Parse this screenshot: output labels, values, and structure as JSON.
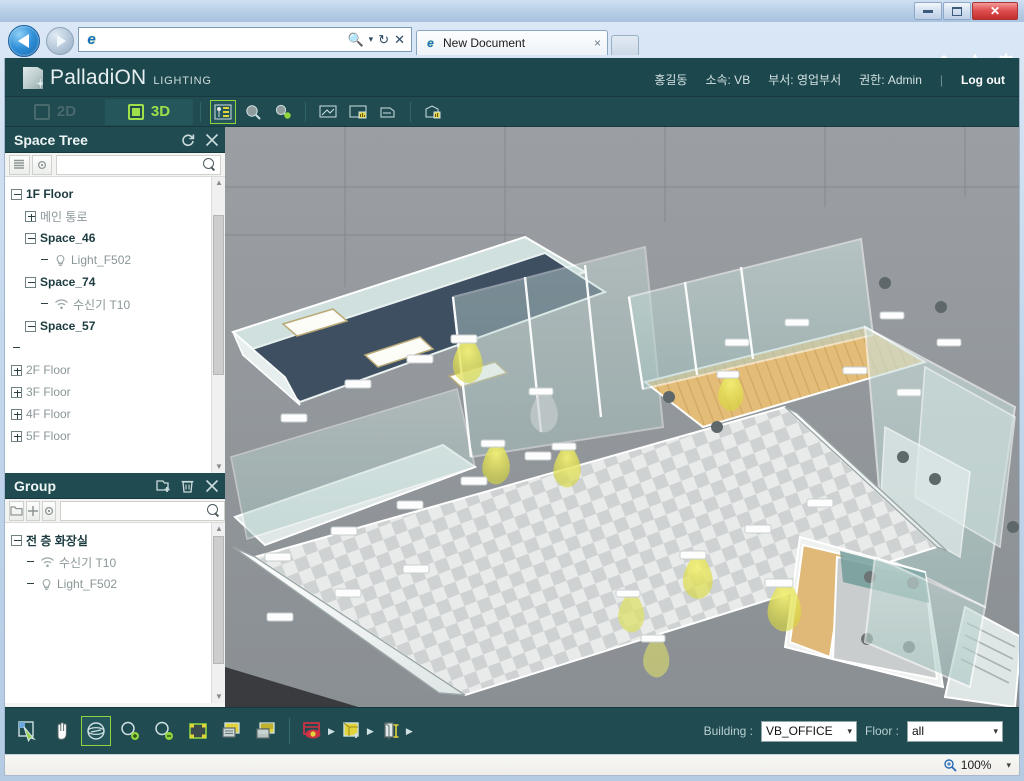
{
  "browser": {
    "window_controls": {
      "minimize": "Minimize",
      "restore": "Restore",
      "close": "Close"
    },
    "back_label": "Back",
    "forward_label": "Forward",
    "address_value": "",
    "address_placeholder": "",
    "address_icons": {
      "search": "search-dropdown",
      "refresh": "refresh",
      "stop": "stop"
    },
    "tabs": [
      {
        "label": "New Document",
        "close": "×"
      }
    ],
    "new_tab_label": "New Tab",
    "tools": {
      "home": "Home",
      "favorites": "Favorites",
      "settings": "Tools"
    },
    "status": {
      "zoom": "100%",
      "zoom_caret": "▾"
    }
  },
  "app_header": {
    "logo_name": "PalladiON",
    "logo_sub": "LIGHTING",
    "user_name": "홍길동",
    "affiliation": "소속: VB",
    "department": "부서: 영업부서",
    "role": "권한: Admin",
    "logout": "Log out"
  },
  "toolbar": {
    "mode_2d": "2D",
    "mode_3d": "3D",
    "active_mode": "3D",
    "buttons": [
      {
        "name": "device-list-icon",
        "active": true
      },
      {
        "name": "search-space-icon",
        "active": false
      },
      {
        "name": "search-settings-icon",
        "active": false
      },
      {
        "name": "monitor-icon",
        "active": false
      },
      {
        "name": "monitor-chart-icon",
        "active": false
      },
      {
        "name": "report-icon",
        "active": false
      },
      {
        "name": "building-chart-icon",
        "active": false
      }
    ]
  },
  "space_tree": {
    "title": "Space Tree",
    "actions": {
      "refresh": "Refresh",
      "close": "Close"
    },
    "toolbar": {
      "list": "list-view",
      "settings": "settings"
    },
    "search_value": "",
    "search_placeholder": "",
    "nodes": [
      {
        "label": "1F Floor",
        "depth": 0,
        "toggle": "minus",
        "style": "bold",
        "icon": "none"
      },
      {
        "label": "메인 통로",
        "depth": 1,
        "toggle": "plus",
        "style": "dim",
        "icon": "none"
      },
      {
        "label": "Space_46",
        "depth": 1,
        "toggle": "minus",
        "style": "bold",
        "icon": "none"
      },
      {
        "label": "Light_F502",
        "depth": 2,
        "toggle": "none",
        "style": "dim",
        "icon": "lamp"
      },
      {
        "label": "Space_74",
        "depth": 1,
        "toggle": "minus",
        "style": "bold",
        "icon": "none"
      },
      {
        "label": "수신기 T10",
        "depth": 2,
        "toggle": "none",
        "style": "dim",
        "icon": "wifi"
      },
      {
        "label": "Space_57",
        "depth": 1,
        "toggle": "minus",
        "style": "bold",
        "icon": "none"
      },
      {
        "label": "",
        "depth": 0,
        "toggle": "none",
        "style": "dim",
        "icon": "none"
      },
      {
        "label": "2F Floor",
        "depth": 0,
        "toggle": "plus",
        "style": "dim",
        "icon": "none"
      },
      {
        "label": "3F Floor",
        "depth": 0,
        "toggle": "plus",
        "style": "dim",
        "icon": "none"
      },
      {
        "label": "4F Floor",
        "depth": 0,
        "toggle": "plus",
        "style": "dim",
        "icon": "none"
      },
      {
        "label": "5F Floor",
        "depth": 0,
        "toggle": "plus",
        "style": "dim",
        "icon": "none"
      }
    ]
  },
  "group_panel": {
    "title": "Group",
    "actions": {
      "add": "Add Group",
      "delete": "Delete",
      "close": "Close"
    },
    "toolbar": {
      "folder": "new-folder",
      "add": "add",
      "settings": "settings"
    },
    "search_value": "",
    "search_placeholder": "",
    "nodes": [
      {
        "label": "전 층 화장실",
        "depth": 0,
        "toggle": "minus",
        "style": "bold",
        "icon": "none"
      },
      {
        "label": "수신기 T10",
        "depth": 1,
        "toggle": "none",
        "style": "dim",
        "icon": "wifi"
      },
      {
        "label": "Light_F502",
        "depth": 1,
        "toggle": "none",
        "style": "dim",
        "icon": "lamp"
      }
    ]
  },
  "bottom_toolbar": {
    "buttons": [
      {
        "name": "select-tool",
        "active": false,
        "caret": false
      },
      {
        "name": "pan-tool",
        "active": false,
        "caret": false
      },
      {
        "name": "orbit-tool",
        "active": true,
        "caret": false
      },
      {
        "name": "zoom-in-tool",
        "active": false,
        "caret": false
      },
      {
        "name": "zoom-out-tool",
        "active": false,
        "caret": false
      },
      {
        "name": "zoom-window-tool",
        "active": false,
        "caret": false
      },
      {
        "name": "view-preset-tool",
        "active": false,
        "caret": false
      },
      {
        "name": "view-render-tool",
        "active": false,
        "caret": false
      },
      {
        "name": "visibility-tool",
        "active": false,
        "caret": true
      },
      {
        "name": "section-box-tool",
        "active": false,
        "caret": true
      },
      {
        "name": "measure-tool",
        "active": false,
        "caret": true
      }
    ],
    "building_label": "Building :",
    "building_value": "VB_OFFICE",
    "floor_label": "Floor :",
    "floor_value": "all",
    "caret": "▾"
  },
  "colors": {
    "app_teal": "#1f4b51",
    "header_teal": "#1b474d",
    "accent_green": "#8fd43c",
    "light_yellow": "#e3e04a",
    "viewport_bg": "#8d9296",
    "glass": "#b9d4d0"
  }
}
